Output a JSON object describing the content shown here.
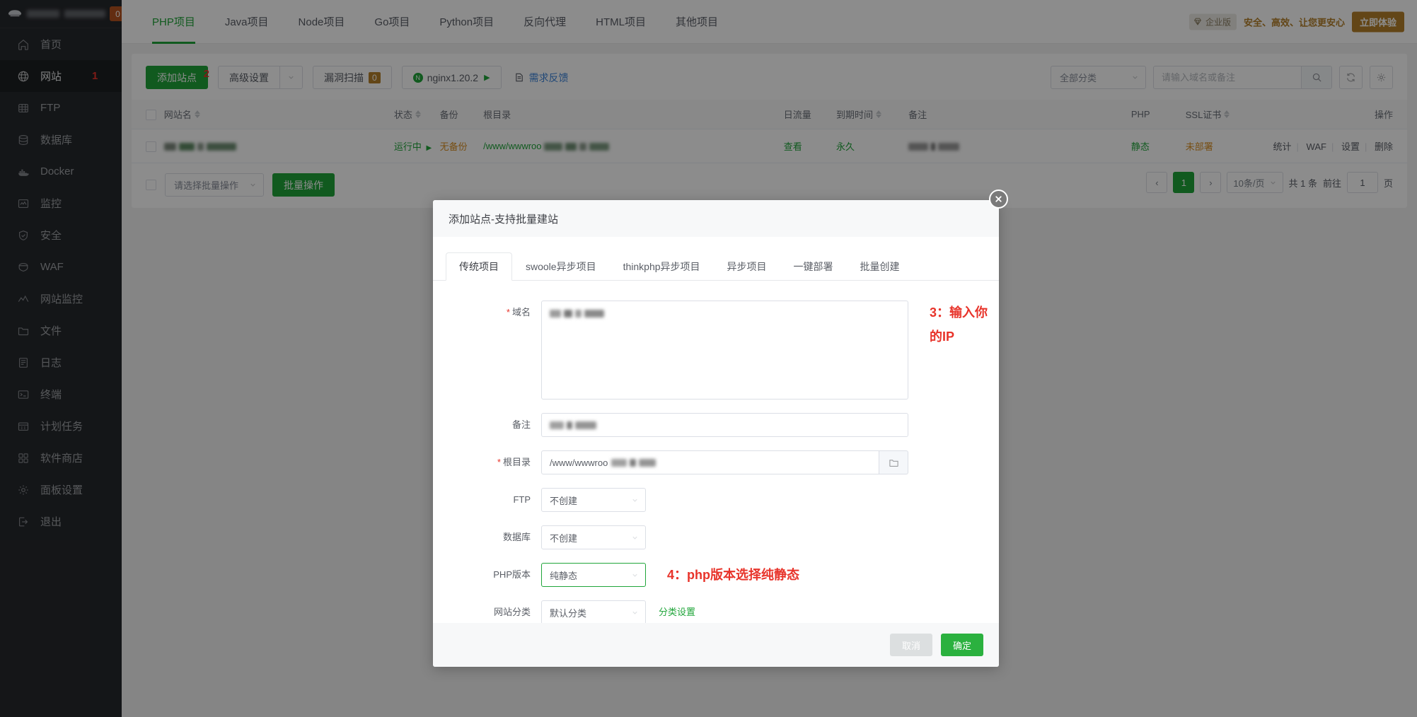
{
  "sidebar": {
    "badge": "0",
    "items": [
      {
        "label": "首页",
        "icon": "home-icon"
      },
      {
        "label": "网站",
        "icon": "globe-icon",
        "active": true,
        "step": "1"
      },
      {
        "label": "FTP",
        "icon": "ftp-icon"
      },
      {
        "label": "数据库",
        "icon": "database-icon"
      },
      {
        "label": "Docker",
        "icon": "docker-icon"
      },
      {
        "label": "监控",
        "icon": "monitor-icon"
      },
      {
        "label": "安全",
        "icon": "shield-icon"
      },
      {
        "label": "WAF",
        "icon": "waf-icon"
      },
      {
        "label": "网站监控",
        "icon": "chart-line-icon"
      },
      {
        "label": "文件",
        "icon": "folder-icon"
      },
      {
        "label": "日志",
        "icon": "log-icon"
      },
      {
        "label": "终端",
        "icon": "terminal-icon"
      },
      {
        "label": "计划任务",
        "icon": "calendar-icon"
      },
      {
        "label": "软件商店",
        "icon": "apps-icon"
      },
      {
        "label": "面板设置",
        "icon": "gear-icon"
      },
      {
        "label": "退出",
        "icon": "logout-icon"
      }
    ]
  },
  "topbar": {
    "tabs": [
      {
        "label": "PHP项目",
        "active": true
      },
      {
        "label": "Java项目"
      },
      {
        "label": "Node项目"
      },
      {
        "label": "Go项目"
      },
      {
        "label": "Python项目"
      },
      {
        "label": "反向代理"
      },
      {
        "label": "HTML项目"
      },
      {
        "label": "其他项目"
      }
    ],
    "promo": {
      "tag": "企业版",
      "text": "安全、高效、让您更安心",
      "button": "立即体验"
    }
  },
  "toolbar": {
    "add_site": "添加站点",
    "add_site_step": "2",
    "advanced": "高级设置",
    "scan": "漏洞扫描",
    "scan_count": "0",
    "nginx": "nginx1.20.2",
    "feedback": "需求反馈",
    "category_filter": "全部分类",
    "search_placeholder": "请输入域名或备注"
  },
  "table": {
    "columns": [
      {
        "label": "网站名",
        "sortable": true
      },
      {
        "label": "状态",
        "sortable": true
      },
      {
        "label": "备份",
        "sortable": false
      },
      {
        "label": "根目录",
        "sortable": false
      },
      {
        "label": "日流量",
        "sortable": false
      },
      {
        "label": "到期时间",
        "sortable": true
      },
      {
        "label": "备注",
        "sortable": false
      },
      {
        "label": "PHP",
        "sortable": false
      },
      {
        "label": "SSL证书",
        "sortable": true
      },
      {
        "label": "操作",
        "sortable": false
      }
    ],
    "rows": [
      {
        "name": "",
        "status": "运行中",
        "backup": "无备份",
        "root": "/www/wwwroo",
        "traffic": "查看",
        "expire": "永久",
        "note": "",
        "php": "静态",
        "ssl": "未部署",
        "ops": [
          "统计",
          "WAF",
          "设置",
          "删除"
        ]
      }
    ]
  },
  "footer": {
    "batch_placeholder": "请选择批量操作",
    "batch_button": "批量操作",
    "page_current": "1",
    "page_size": "10条/页",
    "total": "共 1 条",
    "goto_label": "前往",
    "goto_value": "1",
    "goto_unit": "页"
  },
  "modal": {
    "title": "添加站点-支持批量建站",
    "tabs": [
      {
        "label": "传统项目",
        "active": true
      },
      {
        "label": "swoole异步项目"
      },
      {
        "label": "thinkphp异步项目"
      },
      {
        "label": "异步项目"
      },
      {
        "label": "一键部署"
      },
      {
        "label": "批量创建"
      }
    ],
    "fields": {
      "domain_label": "域名",
      "domain_value": "",
      "domain_annot": "3：输入你的IP",
      "note_label": "备注",
      "note_value": "",
      "root_label": "根目录",
      "root_value": "/www/wwwroo",
      "ftp_label": "FTP",
      "ftp_value": "不创建",
      "db_label": "数据库",
      "db_value": "不创建",
      "php_label": "PHP版本",
      "php_value": "纯静态",
      "php_annot": "4：php版本选择纯静态",
      "category_label": "网站分类",
      "category_value": "默认分类",
      "category_link": "分类设置"
    },
    "cancel": "取消",
    "confirm": "确定"
  },
  "colors": {
    "accent_green": "#20a53a",
    "annotation_red": "#e8332a",
    "warn_orange": "#d98f22",
    "sidebar_bg": "#26282c"
  }
}
